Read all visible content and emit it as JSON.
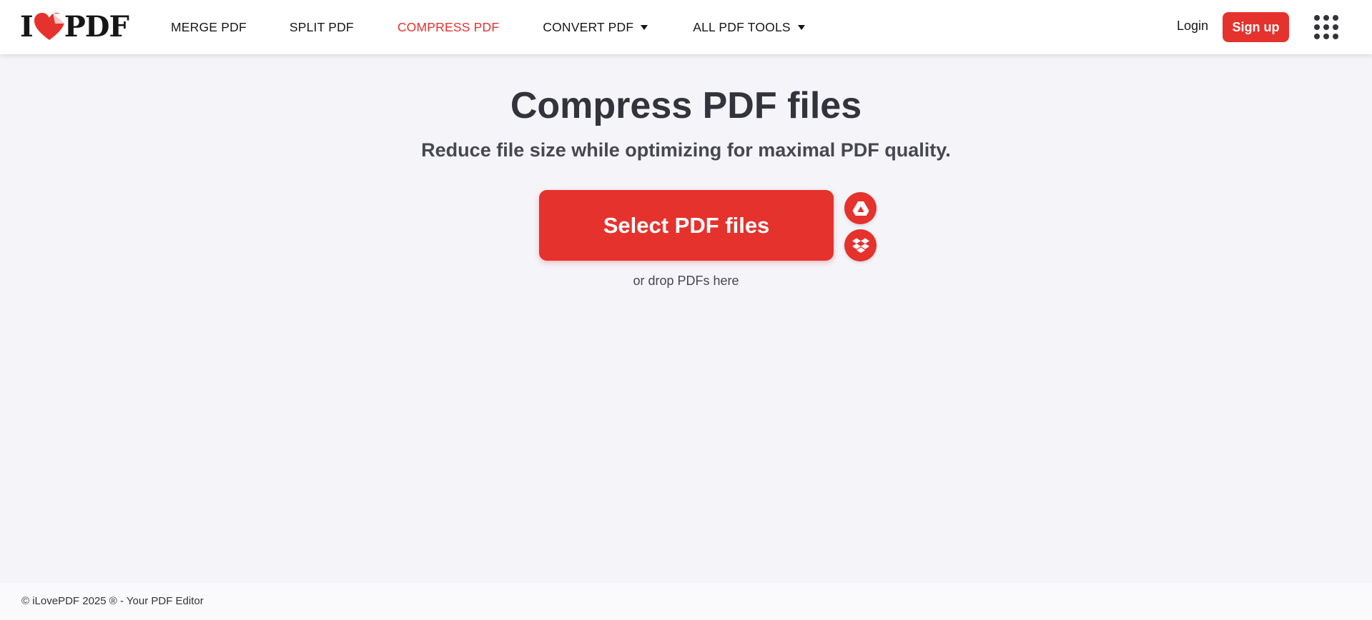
{
  "header": {
    "logo": {
      "prefix": "I",
      "suffix": "PDF",
      "icon": "heart-icon"
    },
    "nav": [
      {
        "label": "MERGE PDF",
        "active": false,
        "dropdown": false
      },
      {
        "label": "SPLIT PDF",
        "active": false,
        "dropdown": false
      },
      {
        "label": "COMPRESS PDF",
        "active": true,
        "dropdown": false
      },
      {
        "label": "CONVERT PDF",
        "active": false,
        "dropdown": true
      },
      {
        "label": "ALL PDF TOOLS",
        "active": false,
        "dropdown": true
      }
    ],
    "login_label": "Login",
    "signup_label": "Sign up",
    "apps_icon": "apps-grid-icon"
  },
  "main": {
    "title": "Compress PDF files",
    "subtitle": "Reduce file size while optimizing for maximal PDF quality.",
    "select_button_label": "Select PDF files",
    "cloud_buttons": [
      {
        "icon": "google-drive-icon"
      },
      {
        "icon": "dropbox-icon"
      }
    ],
    "drop_hint": "or drop PDFs here"
  },
  "footer": {
    "text": "© iLovePDF 2025 ® - Your PDF Editor"
  },
  "colors": {
    "brand_red": "#e5322d",
    "page_background": "#f4f4f9",
    "text_dark": "#33333b",
    "header_background": "#ffffff"
  }
}
